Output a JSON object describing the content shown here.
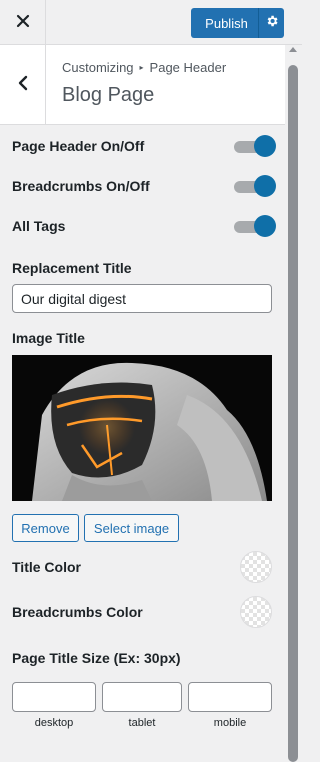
{
  "topbar": {
    "close_icon": "close-icon",
    "publish_label": "Publish",
    "settings_icon": "gear-icon",
    "accent_color": "#2271b1"
  },
  "header": {
    "back_icon": "chevron-left-icon",
    "breadcrumb_root": "Customizing",
    "breadcrumb_separator": "▸",
    "breadcrumb_current": "Page Header",
    "title": "Blog Page"
  },
  "toggles": [
    {
      "label": "Page Header On/Off",
      "on": true
    },
    {
      "label": "Breadcrumbs On/Off",
      "on": true
    },
    {
      "label": "All Tags",
      "on": true
    }
  ],
  "replacement_title": {
    "label": "Replacement Title",
    "value": "Our digital digest"
  },
  "image_title": {
    "label": "Image Title",
    "remove_label": "Remove",
    "select_label": "Select image"
  },
  "colors": [
    {
      "label": "Title Color"
    },
    {
      "label": "Breadcrumbs Color"
    }
  ],
  "title_size": {
    "label": "Page Title Size (Ex: 30px)",
    "devices": [
      "desktop",
      "tablet",
      "mobile"
    ]
  },
  "toggle_on_color": "#0f6fa8"
}
